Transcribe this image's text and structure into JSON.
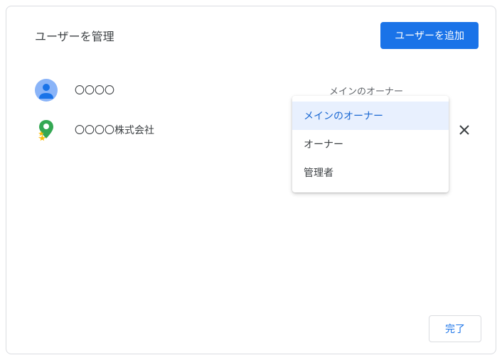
{
  "dialog": {
    "title": "ユーザーを管理",
    "add_user_label": "ユーザーを追加",
    "done_label": "完了"
  },
  "users": [
    {
      "name": "〇〇〇〇",
      "role": "メインのオーナー",
      "removable": false
    },
    {
      "name": "〇〇〇〇株式会社",
      "role": "オーナー",
      "removable": true
    }
  ],
  "role_dropdown": {
    "options": [
      {
        "label": "メインのオーナー",
        "selected": true
      },
      {
        "label": "オーナー",
        "selected": false
      },
      {
        "label": "管理者",
        "selected": false
      }
    ]
  }
}
